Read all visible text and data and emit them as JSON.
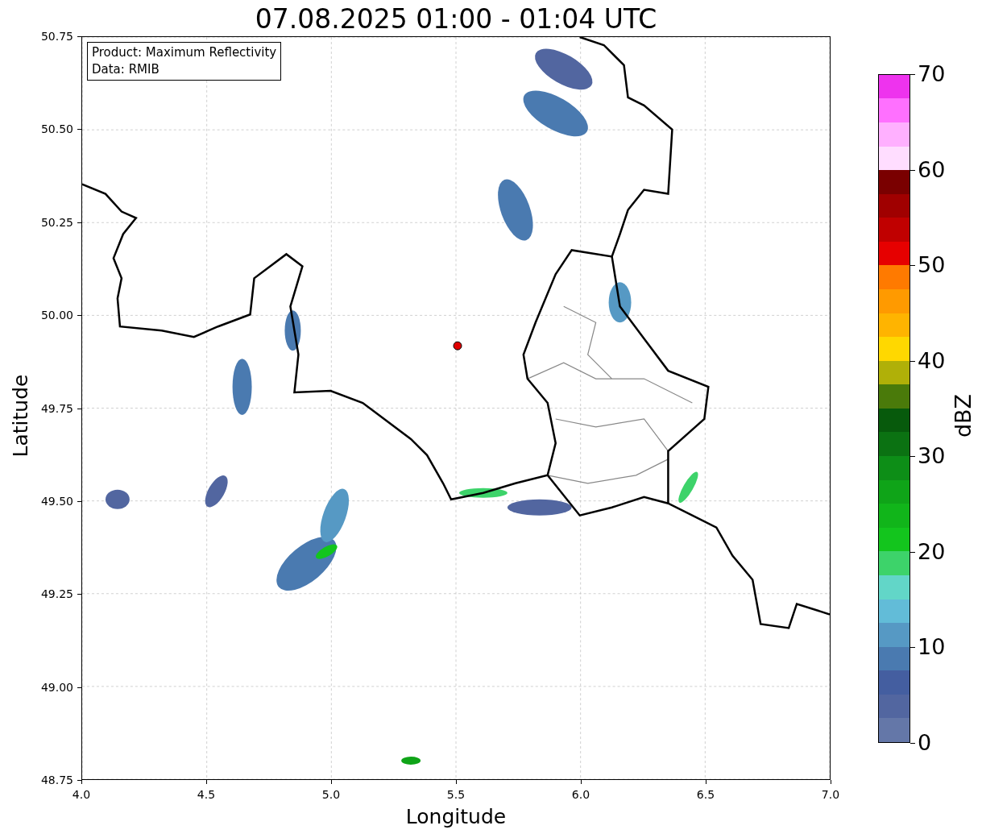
{
  "title": "07.08.2025 01:00 - 01:04 UTC",
  "legend": {
    "lines": [
      "Product: Maximum Reflectivity",
      "Data: RMIB"
    ]
  },
  "axes": {
    "xlabel": "Longitude",
    "ylabel": "Latitude",
    "xticks": [
      "4.0",
      "4.5",
      "5.0",
      "5.5",
      "6.0",
      "6.5",
      "7.0"
    ],
    "yticks": [
      "50.75",
      "50.50",
      "50.25",
      "50.00",
      "49.75",
      "49.50",
      "49.25",
      "49.00",
      "48.75"
    ]
  },
  "colorbar": {
    "label": "dBZ",
    "ticks": [
      "70",
      "60",
      "50",
      "40",
      "30",
      "20",
      "10",
      "0"
    ],
    "segments": [
      {
        "color": "#6477a8"
      },
      {
        "color": "#5266a0"
      },
      {
        "color": "#445ea0"
      },
      {
        "color": "#4a7ab0"
      },
      {
        "color": "#5699c4"
      },
      {
        "color": "#62bcd8"
      },
      {
        "color": "#62d6c8"
      },
      {
        "color": "#3dd36a"
      },
      {
        "color": "#13c51d"
      },
      {
        "color": "#11b51a"
      },
      {
        "color": "#0fa418"
      },
      {
        "color": "#0d8e17"
      },
      {
        "color": "#0b7212"
      },
      {
        "color": "#075a0c"
      },
      {
        "color": "#4a7a0a"
      },
      {
        "color": "#b0b008"
      },
      {
        "color": "#ffd800"
      },
      {
        "color": "#ffb400"
      },
      {
        "color": "#ff9a00"
      },
      {
        "color": "#ff7a00"
      },
      {
        "color": "#e60000"
      },
      {
        "color": "#c00000"
      },
      {
        "color": "#a00000"
      },
      {
        "color": "#7a0000"
      },
      {
        "color": "#ffddff"
      },
      {
        "color": "#ffb0ff"
      },
      {
        "color": "#ff70ff"
      },
      {
        "color": "#ee33ee"
      }
    ]
  }
}
